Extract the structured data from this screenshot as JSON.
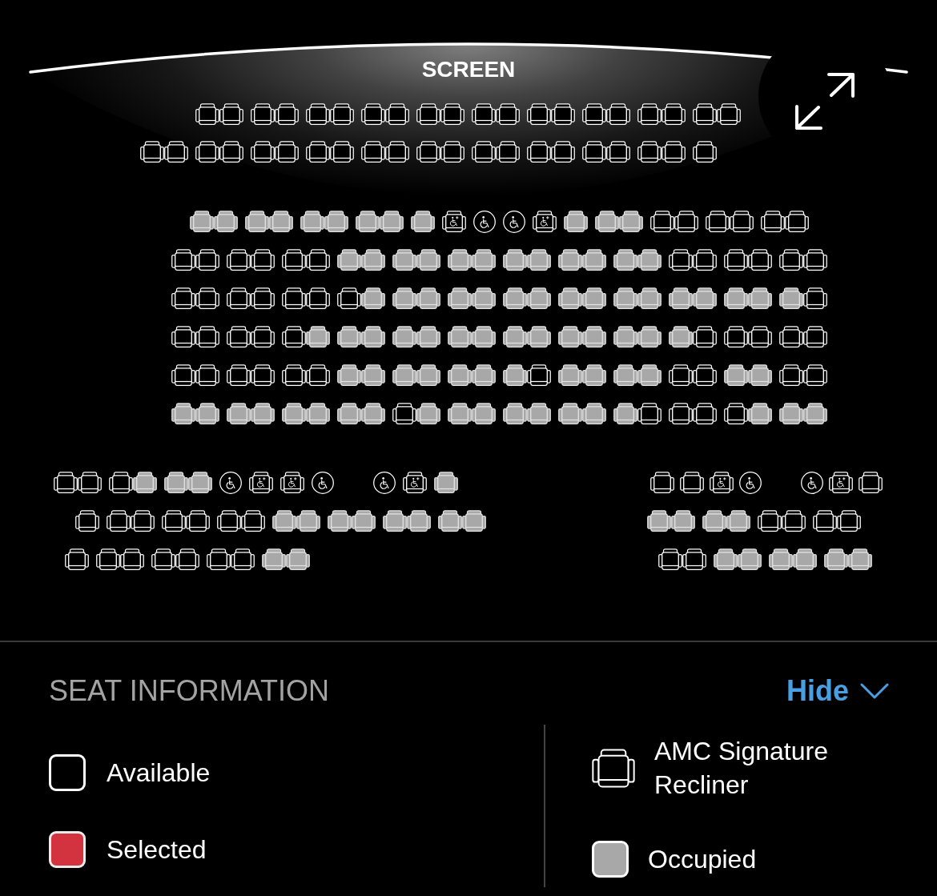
{
  "screen": {
    "label": "SCREEN"
  },
  "seat_map": {
    "front_section": {
      "rows": [
        {
          "groups": [
            [
              {
                "kind": "recliner",
                "occupied": false
              },
              {
                "kind": "recliner",
                "occupied": false
              }
            ],
            [
              {
                "kind": "recliner",
                "occupied": false
              },
              {
                "kind": "recliner",
                "occupied": false
              }
            ],
            [
              {
                "kind": "recliner",
                "occupied": false
              },
              {
                "kind": "recliner",
                "occupied": false
              }
            ],
            [
              {
                "kind": "recliner",
                "occupied": false
              },
              {
                "kind": "recliner",
                "occupied": false
              }
            ],
            [
              {
                "kind": "recliner",
                "occupied": false
              },
              {
                "kind": "recliner",
                "occupied": false
              }
            ],
            [
              {
                "kind": "recliner",
                "occupied": false
              },
              {
                "kind": "recliner",
                "occupied": false
              }
            ],
            [
              {
                "kind": "recliner",
                "occupied": false
              },
              {
                "kind": "recliner",
                "occupied": false
              }
            ],
            [
              {
                "kind": "recliner",
                "occupied": false
              },
              {
                "kind": "recliner",
                "occupied": false
              }
            ],
            [
              {
                "kind": "recliner",
                "occupied": false
              },
              {
                "kind": "recliner",
                "occupied": false
              }
            ],
            [
              {
                "kind": "recliner",
                "occupied": false
              },
              {
                "kind": "recliner",
                "occupied": false
              }
            ]
          ]
        },
        {
          "groups": [
            [
              {
                "kind": "recliner",
                "occupied": false
              },
              {
                "kind": "recliner",
                "occupied": false
              }
            ],
            [
              {
                "kind": "recliner",
                "occupied": false
              },
              {
                "kind": "recliner",
                "occupied": false
              }
            ],
            [
              {
                "kind": "recliner",
                "occupied": false
              },
              {
                "kind": "recliner",
                "occupied": false
              }
            ],
            [
              {
                "kind": "recliner",
                "occupied": false
              },
              {
                "kind": "recliner",
                "occupied": false
              }
            ],
            [
              {
                "kind": "recliner",
                "occupied": false
              },
              {
                "kind": "recliner",
                "occupied": false
              }
            ],
            [
              {
                "kind": "recliner",
                "occupied": false
              },
              {
                "kind": "recliner",
                "occupied": false
              }
            ],
            [
              {
                "kind": "recliner",
                "occupied": false
              },
              {
                "kind": "recliner",
                "occupied": false
              }
            ],
            [
              {
                "kind": "recliner",
                "occupied": false
              },
              {
                "kind": "recliner",
                "occupied": false
              }
            ],
            [
              {
                "kind": "recliner",
                "occupied": false
              },
              {
                "kind": "recliner",
                "occupied": false
              }
            ],
            [
              {
                "kind": "recliner",
                "occupied": false
              },
              {
                "kind": "recliner",
                "occupied": false
              }
            ],
            [
              {
                "kind": "recliner",
                "occupied": false
              }
            ]
          ]
        }
      ]
    },
    "center_section": {
      "rows": [
        {
          "groups": [
            [
              {
                "kind": "recliner",
                "occupied": true
              },
              {
                "kind": "recliner",
                "occupied": true
              }
            ],
            [
              {
                "kind": "recliner",
                "occupied": true
              },
              {
                "kind": "recliner",
                "occupied": true
              }
            ],
            [
              {
                "kind": "recliner",
                "occupied": true
              },
              {
                "kind": "recliner",
                "occupied": true
              }
            ],
            [
              {
                "kind": "recliner",
                "occupied": true
              },
              {
                "kind": "recliner",
                "occupied": true
              }
            ],
            [
              {
                "kind": "recliner",
                "occupied": true
              }
            ],
            [
              {
                "kind": "companion",
                "occupied": false
              }
            ],
            [
              {
                "kind": "wheelchair",
                "occupied": false
              }
            ],
            [
              {
                "kind": "wheelchair",
                "occupied": false
              }
            ],
            [
              {
                "kind": "companion",
                "occupied": false
              }
            ],
            [
              {
                "kind": "recliner",
                "occupied": true
              }
            ],
            [
              {
                "kind": "recliner",
                "occupied": true
              },
              {
                "kind": "recliner",
                "occupied": true
              }
            ],
            [
              {
                "kind": "recliner",
                "occupied": false
              },
              {
                "kind": "recliner",
                "occupied": false
              }
            ],
            [
              {
                "kind": "recliner",
                "occupied": false
              },
              {
                "kind": "recliner",
                "occupied": false
              }
            ],
            [
              {
                "kind": "recliner",
                "occupied": false
              },
              {
                "kind": "recliner",
                "occupied": false
              }
            ]
          ]
        },
        {
          "groups": [
            [
              {
                "kind": "recliner",
                "occupied": false
              },
              {
                "kind": "recliner",
                "occupied": false
              }
            ],
            [
              {
                "kind": "recliner",
                "occupied": false
              },
              {
                "kind": "recliner",
                "occupied": false
              }
            ],
            [
              {
                "kind": "recliner",
                "occupied": false
              },
              {
                "kind": "recliner",
                "occupied": false
              }
            ],
            [
              {
                "kind": "recliner",
                "occupied": true
              },
              {
                "kind": "recliner",
                "occupied": true
              }
            ],
            [
              {
                "kind": "recliner",
                "occupied": true
              },
              {
                "kind": "recliner",
                "occupied": true
              }
            ],
            [
              {
                "kind": "recliner",
                "occupied": true
              },
              {
                "kind": "recliner",
                "occupied": true
              }
            ],
            [
              {
                "kind": "recliner",
                "occupied": true
              },
              {
                "kind": "recliner",
                "occupied": true
              }
            ],
            [
              {
                "kind": "recliner",
                "occupied": true
              },
              {
                "kind": "recliner",
                "occupied": true
              }
            ],
            [
              {
                "kind": "recliner",
                "occupied": true
              },
              {
                "kind": "recliner",
                "occupied": true
              }
            ],
            [
              {
                "kind": "recliner",
                "occupied": false
              },
              {
                "kind": "recliner",
                "occupied": false
              }
            ],
            [
              {
                "kind": "recliner",
                "occupied": false
              },
              {
                "kind": "recliner",
                "occupied": false
              }
            ],
            [
              {
                "kind": "recliner",
                "occupied": false
              },
              {
                "kind": "recliner",
                "occupied": false
              }
            ]
          ]
        },
        {
          "groups": [
            [
              {
                "kind": "recliner",
                "occupied": false
              },
              {
                "kind": "recliner",
                "occupied": false
              }
            ],
            [
              {
                "kind": "recliner",
                "occupied": false
              },
              {
                "kind": "recliner",
                "occupied": false
              }
            ],
            [
              {
                "kind": "recliner",
                "occupied": false
              },
              {
                "kind": "recliner",
                "occupied": false
              }
            ],
            [
              {
                "kind": "recliner",
                "occupied": false
              },
              {
                "kind": "recliner",
                "occupied": true
              }
            ],
            [
              {
                "kind": "recliner",
                "occupied": true
              },
              {
                "kind": "recliner",
                "occupied": true
              }
            ],
            [
              {
                "kind": "recliner",
                "occupied": true
              },
              {
                "kind": "recliner",
                "occupied": true
              }
            ],
            [
              {
                "kind": "recliner",
                "occupied": true
              },
              {
                "kind": "recliner",
                "occupied": true
              }
            ],
            [
              {
                "kind": "recliner",
                "occupied": true
              },
              {
                "kind": "recliner",
                "occupied": true
              }
            ],
            [
              {
                "kind": "recliner",
                "occupied": true
              },
              {
                "kind": "recliner",
                "occupied": true
              }
            ],
            [
              {
                "kind": "recliner",
                "occupied": true
              },
              {
                "kind": "recliner",
                "occupied": true
              }
            ],
            [
              {
                "kind": "recliner",
                "occupied": true
              },
              {
                "kind": "recliner",
                "occupied": true
              }
            ],
            [
              {
                "kind": "recliner",
                "occupied": true
              },
              {
                "kind": "recliner",
                "occupied": false
              }
            ]
          ]
        },
        {
          "groups": [
            [
              {
                "kind": "recliner",
                "occupied": false
              },
              {
                "kind": "recliner",
                "occupied": false
              }
            ],
            [
              {
                "kind": "recliner",
                "occupied": false
              },
              {
                "kind": "recliner",
                "occupied": false
              }
            ],
            [
              {
                "kind": "recliner",
                "occupied": false
              },
              {
                "kind": "recliner",
                "occupied": true
              }
            ],
            [
              {
                "kind": "recliner",
                "occupied": true
              },
              {
                "kind": "recliner",
                "occupied": true
              }
            ],
            [
              {
                "kind": "recliner",
                "occupied": true
              },
              {
                "kind": "recliner",
                "occupied": true
              }
            ],
            [
              {
                "kind": "recliner",
                "occupied": true
              },
              {
                "kind": "recliner",
                "occupied": true
              }
            ],
            [
              {
                "kind": "recliner",
                "occupied": true
              },
              {
                "kind": "recliner",
                "occupied": true
              }
            ],
            [
              {
                "kind": "recliner",
                "occupied": true
              },
              {
                "kind": "recliner",
                "occupied": true
              }
            ],
            [
              {
                "kind": "recliner",
                "occupied": true
              },
              {
                "kind": "recliner",
                "occupied": true
              }
            ],
            [
              {
                "kind": "recliner",
                "occupied": true
              },
              {
                "kind": "recliner",
                "occupied": false
              }
            ],
            [
              {
                "kind": "recliner",
                "occupied": false
              },
              {
                "kind": "recliner",
                "occupied": false
              }
            ],
            [
              {
                "kind": "recliner",
                "occupied": false
              },
              {
                "kind": "recliner",
                "occupied": false
              }
            ]
          ]
        },
        {
          "groups": [
            [
              {
                "kind": "recliner",
                "occupied": false
              },
              {
                "kind": "recliner",
                "occupied": false
              }
            ],
            [
              {
                "kind": "recliner",
                "occupied": false
              },
              {
                "kind": "recliner",
                "occupied": false
              }
            ],
            [
              {
                "kind": "recliner",
                "occupied": false
              },
              {
                "kind": "recliner",
                "occupied": false
              }
            ],
            [
              {
                "kind": "recliner",
                "occupied": true
              },
              {
                "kind": "recliner",
                "occupied": true
              }
            ],
            [
              {
                "kind": "recliner",
                "occupied": true
              },
              {
                "kind": "recliner",
                "occupied": true
              }
            ],
            [
              {
                "kind": "recliner",
                "occupied": true
              },
              {
                "kind": "recliner",
                "occupied": true
              }
            ],
            [
              {
                "kind": "recliner",
                "occupied": true
              },
              {
                "kind": "recliner",
                "occupied": false
              }
            ],
            [
              {
                "kind": "recliner",
                "occupied": true
              },
              {
                "kind": "recliner",
                "occupied": true
              }
            ],
            [
              {
                "kind": "recliner",
                "occupied": true
              },
              {
                "kind": "recliner",
                "occupied": true
              }
            ],
            [
              {
                "kind": "recliner",
                "occupied": false
              },
              {
                "kind": "recliner",
                "occupied": false
              }
            ],
            [
              {
                "kind": "recliner",
                "occupied": true
              },
              {
                "kind": "recliner",
                "occupied": true
              }
            ],
            [
              {
                "kind": "recliner",
                "occupied": false
              },
              {
                "kind": "recliner",
                "occupied": false
              }
            ]
          ]
        },
        {
          "groups": [
            [
              {
                "kind": "recliner",
                "occupied": true
              },
              {
                "kind": "recliner",
                "occupied": true
              }
            ],
            [
              {
                "kind": "recliner",
                "occupied": true
              },
              {
                "kind": "recliner",
                "occupied": true
              }
            ],
            [
              {
                "kind": "recliner",
                "occupied": true
              },
              {
                "kind": "recliner",
                "occupied": true
              }
            ],
            [
              {
                "kind": "recliner",
                "occupied": true
              },
              {
                "kind": "recliner",
                "occupied": true
              }
            ],
            [
              {
                "kind": "recliner",
                "occupied": false
              },
              {
                "kind": "recliner",
                "occupied": true
              }
            ],
            [
              {
                "kind": "recliner",
                "occupied": true
              },
              {
                "kind": "recliner",
                "occupied": true
              }
            ],
            [
              {
                "kind": "recliner",
                "occupied": true
              },
              {
                "kind": "recliner",
                "occupied": true
              }
            ],
            [
              {
                "kind": "recliner",
                "occupied": true
              },
              {
                "kind": "recliner",
                "occupied": true
              }
            ],
            [
              {
                "kind": "recliner",
                "occupied": true
              },
              {
                "kind": "recliner",
                "occupied": false
              }
            ],
            [
              {
                "kind": "recliner",
                "occupied": false
              },
              {
                "kind": "recliner",
                "occupied": false
              }
            ],
            [
              {
                "kind": "recliner",
                "occupied": false
              },
              {
                "kind": "recliner",
                "occupied": true
              }
            ],
            [
              {
                "kind": "recliner",
                "occupied": true
              },
              {
                "kind": "recliner",
                "occupied": true
              }
            ]
          ]
        }
      ]
    },
    "left_section": {
      "rows": [
        {
          "groups": [
            [
              {
                "kind": "recliner",
                "occupied": false
              },
              {
                "kind": "recliner",
                "occupied": false
              }
            ],
            [
              {
                "kind": "recliner",
                "occupied": false
              },
              {
                "kind": "recliner",
                "occupied": true
              }
            ],
            [
              {
                "kind": "recliner",
                "occupied": true
              },
              {
                "kind": "recliner",
                "occupied": true
              }
            ],
            [
              {
                "kind": "wheelchair",
                "occupied": false
              }
            ],
            [
              {
                "kind": "companion",
                "occupied": false
              }
            ],
            [
              {
                "kind": "companion",
                "occupied": false
              }
            ],
            [
              {
                "kind": "wheelchair",
                "occupied": false
              }
            ],
            [
              {
                "kind": "wheelchair",
                "occupied": false
              }
            ],
            [
              {
                "kind": "companion",
                "occupied": false
              }
            ],
            [
              {
                "kind": "recliner",
                "occupied": true
              }
            ]
          ]
        },
        {
          "groups": [
            [
              {
                "kind": "recliner",
                "occupied": false
              }
            ],
            [
              {
                "kind": "recliner",
                "occupied": false
              },
              {
                "kind": "recliner",
                "occupied": false
              }
            ],
            [
              {
                "kind": "recliner",
                "occupied": false
              },
              {
                "kind": "recliner",
                "occupied": false
              }
            ],
            [
              {
                "kind": "recliner",
                "occupied": false
              },
              {
                "kind": "recliner",
                "occupied": false
              }
            ],
            [
              {
                "kind": "recliner",
                "occupied": true
              },
              {
                "kind": "recliner",
                "occupied": true
              }
            ],
            [
              {
                "kind": "recliner",
                "occupied": true
              },
              {
                "kind": "recliner",
                "occupied": true
              }
            ],
            [
              {
                "kind": "recliner",
                "occupied": true
              },
              {
                "kind": "recliner",
                "occupied": true
              }
            ],
            [
              {
                "kind": "recliner",
                "occupied": true
              },
              {
                "kind": "recliner",
                "occupied": true
              }
            ]
          ]
        },
        {
          "groups": [
            [
              {
                "kind": "recliner",
                "occupied": false
              }
            ],
            [
              {
                "kind": "recliner",
                "occupied": false
              },
              {
                "kind": "recliner",
                "occupied": false
              }
            ],
            [
              {
                "kind": "recliner",
                "occupied": false
              },
              {
                "kind": "recliner",
                "occupied": false
              }
            ],
            [
              {
                "kind": "recliner",
                "occupied": false
              },
              {
                "kind": "recliner",
                "occupied": false
              }
            ],
            [
              {
                "kind": "recliner",
                "occupied": true
              },
              {
                "kind": "recliner",
                "occupied": true
              }
            ]
          ]
        }
      ]
    },
    "right_section": {
      "rows": [
        {
          "groups": [
            [
              {
                "kind": "recliner",
                "occupied": false
              }
            ],
            [
              {
                "kind": "recliner",
                "occupied": false
              }
            ],
            [
              {
                "kind": "companion",
                "occupied": false
              }
            ],
            [
              {
                "kind": "wheelchair",
                "occupied": false
              }
            ],
            [
              {
                "kind": "wheelchair",
                "occupied": false
              }
            ],
            [
              {
                "kind": "companion",
                "occupied": false
              }
            ],
            [
              {
                "kind": "recliner",
                "occupied": false
              }
            ]
          ]
        },
        {
          "groups": [
            [
              {
                "kind": "recliner",
                "occupied": true
              },
              {
                "kind": "recliner",
                "occupied": true
              }
            ],
            [
              {
                "kind": "recliner",
                "occupied": true
              },
              {
                "kind": "recliner",
                "occupied": true
              }
            ],
            [
              {
                "kind": "recliner",
                "occupied": false
              },
              {
                "kind": "recliner",
                "occupied": false
              }
            ],
            [
              {
                "kind": "recliner",
                "occupied": false
              },
              {
                "kind": "recliner",
                "occupied": false
              }
            ]
          ]
        },
        {
          "groups": [
            [
              {
                "kind": "recliner",
                "occupied": false
              },
              {
                "kind": "recliner",
                "occupied": false
              }
            ],
            [
              {
                "kind": "recliner",
                "occupied": true
              },
              {
                "kind": "recliner",
                "occupied": true
              }
            ],
            [
              {
                "kind": "recliner",
                "occupied": true
              },
              {
                "kind": "recliner",
                "occupied": true
              }
            ],
            [
              {
                "kind": "recliner",
                "occupied": true
              },
              {
                "kind": "recliner",
                "occupied": true
              }
            ]
          ]
        }
      ]
    }
  },
  "seat_information": {
    "title": "SEAT INFORMATION",
    "toggle": {
      "label": "Hide",
      "expanded": true
    },
    "legend_columns": [
      {
        "items": [
          {
            "kind": "available",
            "label": "Available"
          },
          {
            "kind": "selected",
            "label": "Selected"
          }
        ]
      },
      {
        "items": [
          {
            "kind": "recliner",
            "label": "AMC Signature Recliner"
          },
          {
            "kind": "occupied",
            "label": "Occupied"
          }
        ]
      }
    ]
  }
}
